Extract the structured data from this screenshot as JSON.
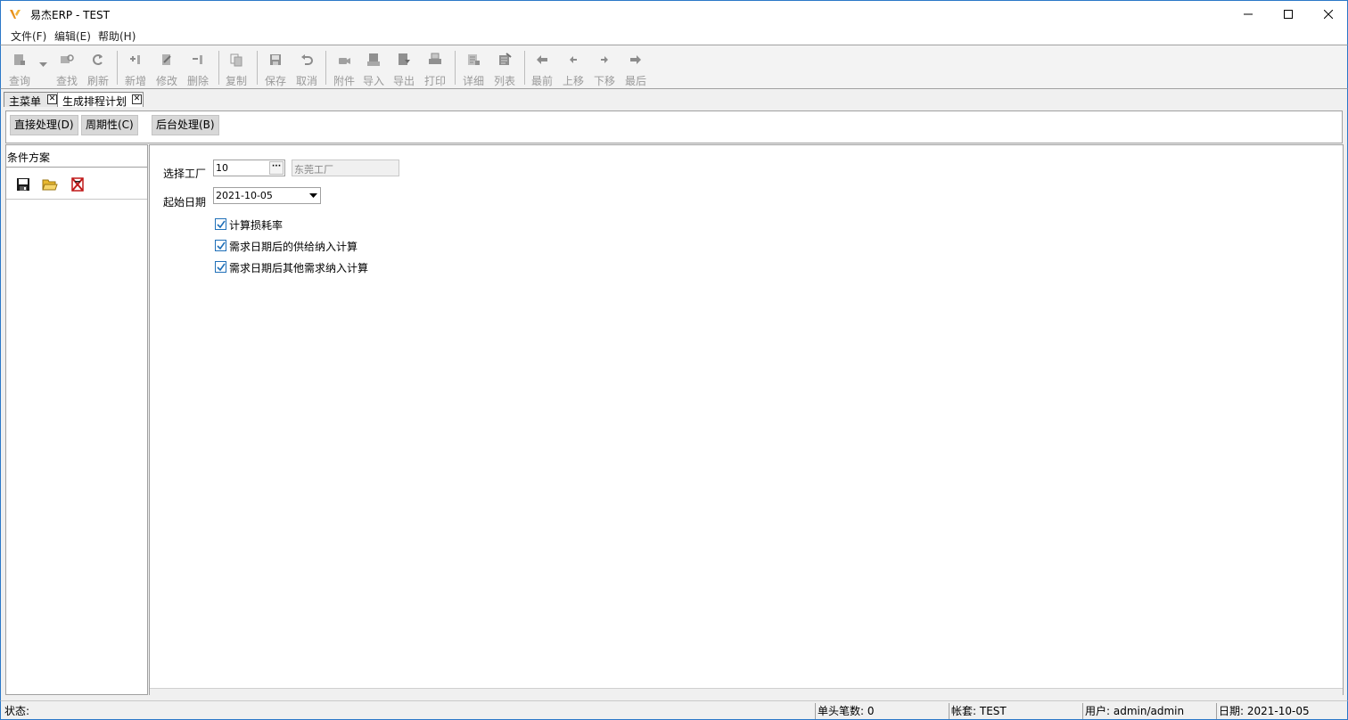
{
  "window": {
    "title": "易杰ERP - TEST",
    "logo": "yijie-logo-icon",
    "controls": [
      "minimize-icon",
      "maximize-icon",
      "close-icon"
    ]
  },
  "menu": {
    "items": [
      {
        "label": "文件(F)"
      },
      {
        "label": "编辑(E)"
      },
      {
        "label": "帮助(H)"
      }
    ]
  },
  "toolbar": {
    "buttons": [
      {
        "label": "查询",
        "icon": "query-icon"
      },
      {
        "label": "查找",
        "icon": "find-icon"
      },
      {
        "label": "刷新",
        "icon": "refresh-icon"
      },
      {
        "label": "新增",
        "icon": "add-icon"
      },
      {
        "label": "修改",
        "icon": "edit-icon"
      },
      {
        "label": "删除",
        "icon": "delete-icon"
      },
      {
        "label": "复制",
        "icon": "copy-icon"
      },
      {
        "label": "保存",
        "icon": "save-icon"
      },
      {
        "label": "取消",
        "icon": "undo-icon"
      },
      {
        "label": "附件",
        "icon": "attachment-icon"
      },
      {
        "label": "导入",
        "icon": "import-icon"
      },
      {
        "label": "导出",
        "icon": "export-icon"
      },
      {
        "label": "打印",
        "icon": "print-icon"
      },
      {
        "label": "详细",
        "icon": "detail-icon"
      },
      {
        "label": "列表",
        "icon": "list-icon"
      },
      {
        "label": "最前",
        "icon": "first-icon"
      },
      {
        "label": "上移",
        "icon": "previous-icon"
      },
      {
        "label": "下移",
        "icon": "next-icon"
      },
      {
        "label": "最后",
        "icon": "last-icon"
      }
    ]
  },
  "tabs": [
    {
      "label": "主菜单",
      "close": "✕"
    },
    {
      "label": "生成排程计划",
      "close": "✕"
    }
  ],
  "actions": [
    {
      "label": "直接处理(D)"
    },
    {
      "label": "周期性(C)"
    },
    {
      "label": "后台处理(B)"
    }
  ],
  "left_panel": {
    "title": "条件方案",
    "icons": [
      "save-scheme-icon",
      "open-folder-icon",
      "delete-scheme-icon"
    ]
  },
  "form": {
    "factory_label": "选择工厂",
    "factory_code": "10",
    "factory_button": "···",
    "factory_name": "东莞工厂",
    "start_date_label": "起始日期",
    "start_date": "2021-10-05",
    "checkboxes": [
      {
        "label": "计算损耗率",
        "checked": true
      },
      {
        "label": "需求日期后的供给纳入计算",
        "checked": true
      },
      {
        "label": "需求日期后其他需求纳入计算",
        "checked": true
      }
    ]
  },
  "status": {
    "state": "状态:",
    "headers": "单头笔数: 0",
    "account": "帐套: TEST",
    "user": "用户: admin/admin",
    "date": "日期: 2021-10-05"
  },
  "colors": {
    "window_border": "#2b78c8",
    "disabled_text": "#9a9a9a",
    "checkbox_blue": "#1f6fb8"
  }
}
